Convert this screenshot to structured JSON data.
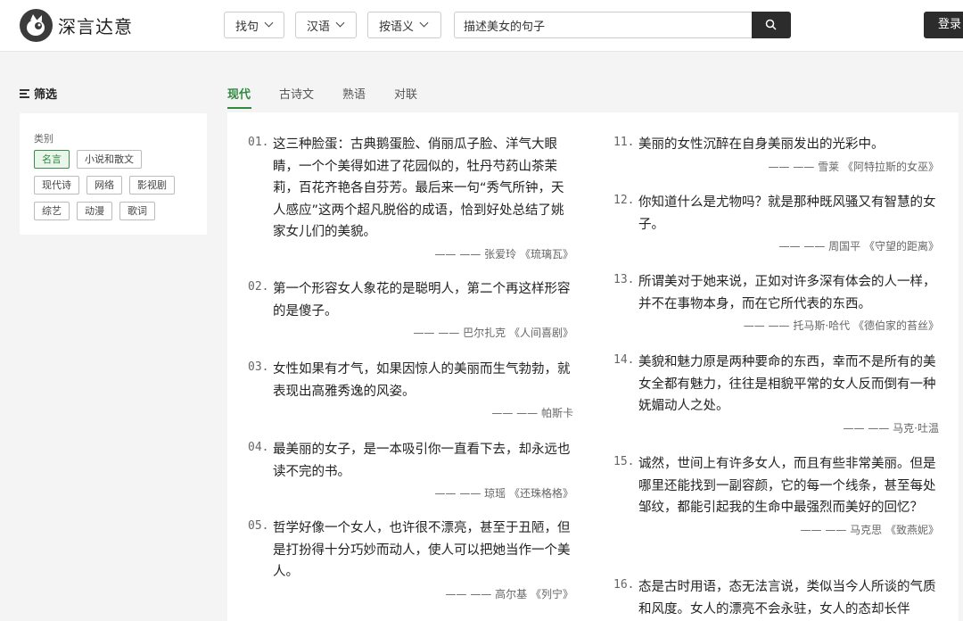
{
  "header": {
    "logo_text": "深言达意",
    "selects": [
      {
        "label": "找句"
      },
      {
        "label": "汉语"
      },
      {
        "label": "按语义"
      }
    ],
    "search_value": "描述美女的句子",
    "login_label": "登录"
  },
  "sidebar": {
    "filter_title": "筛选",
    "category_label": "类别",
    "tags": [
      "名言",
      "小说和散文",
      "现代诗",
      "网络",
      "影视剧",
      "综艺",
      "动漫",
      "歌词"
    ],
    "active_tag": "名言"
  },
  "tabs": [
    "现代",
    "古诗文",
    "熟语",
    "对联"
  ],
  "active_tab": "现代",
  "quotes_left": [
    {
      "num": "01.",
      "text": "这三种脸蛋：古典鹅蛋脸、俏丽瓜子脸、洋气大眼睛，一个个美得如进了花园似的，牡丹芍药山茶茉莉，百花齐艳各自芬芳。最后来一句“秀气所钟，天人感应”这两个超凡脱俗的成语，恰到好处总结了姚家女儿们的美貌。",
      "source": "—— —— 张爱玲 《琉璃瓦》"
    },
    {
      "num": "02.",
      "text": "第一个形容女人象花的是聪明人，第二个再这样形容的是傻子。",
      "source": "—— —— 巴尔扎克 《人间喜剧》"
    },
    {
      "num": "03.",
      "text": "女性如果有才气，如果因惊人的美丽而生气勃勃，就表现出高雅秀逸的风姿。",
      "source": "—— —— 帕斯卡"
    },
    {
      "num": "04.",
      "text": "最美丽的女子，是一本吸引你一直看下去，却永远也读不完的书。",
      "source": "—— —— 琼瑶 《还珠格格》"
    },
    {
      "num": "05.",
      "text": "哲学好像一个女人，也许很不漂亮，甚至于丑陋，但是打扮得十分巧妙而动人，使人可以把她当作一个美人。",
      "source": "—— —— 高尔基 《列宁》"
    }
  ],
  "quotes_right": [
    {
      "num": "11.",
      "text": "美丽的女性沉醉在自身美丽发出的光彩中。",
      "source": "—— —— 雪莱 《阿特拉斯的女巫》"
    },
    {
      "num": "12.",
      "text": "你知道什么是尤物吗？就是那种既风骚又有智慧的女子。",
      "source": "—— —— 周国平 《守望的距离》"
    },
    {
      "num": "13.",
      "text": "所谓美对于她来说，正如对许多深有体会的人一样，并不在事物本身，而在它所代表的东西。",
      "source": "—— —— 托马斯·哈代 《德伯家的苔丝》"
    },
    {
      "num": "14.",
      "text": "美貌和魅力原是两种要命的东西，幸而不是所有的美女全都有魅力，往往是相貌平常的女人反而倒有一种妩媚动人之处。",
      "source": "—— —— 马克·吐温"
    },
    {
      "num": "15.",
      "text": "诚然，世间上有许多女人，而且有些非常美丽。但是哪里还能找到一副容颜，它的每一个线条，甚至每处邹纹，都能引起我的生命中最强烈而美好的回忆？",
      "source": "—— —— 马克思 《致燕妮》"
    },
    {
      "num": "16.",
      "text": "态是古时用语，态无法言说，类似当今人所谈的气质和风度。女人的漂亮不会永驻，女人的态却长伴",
      "source": ""
    }
  ]
}
